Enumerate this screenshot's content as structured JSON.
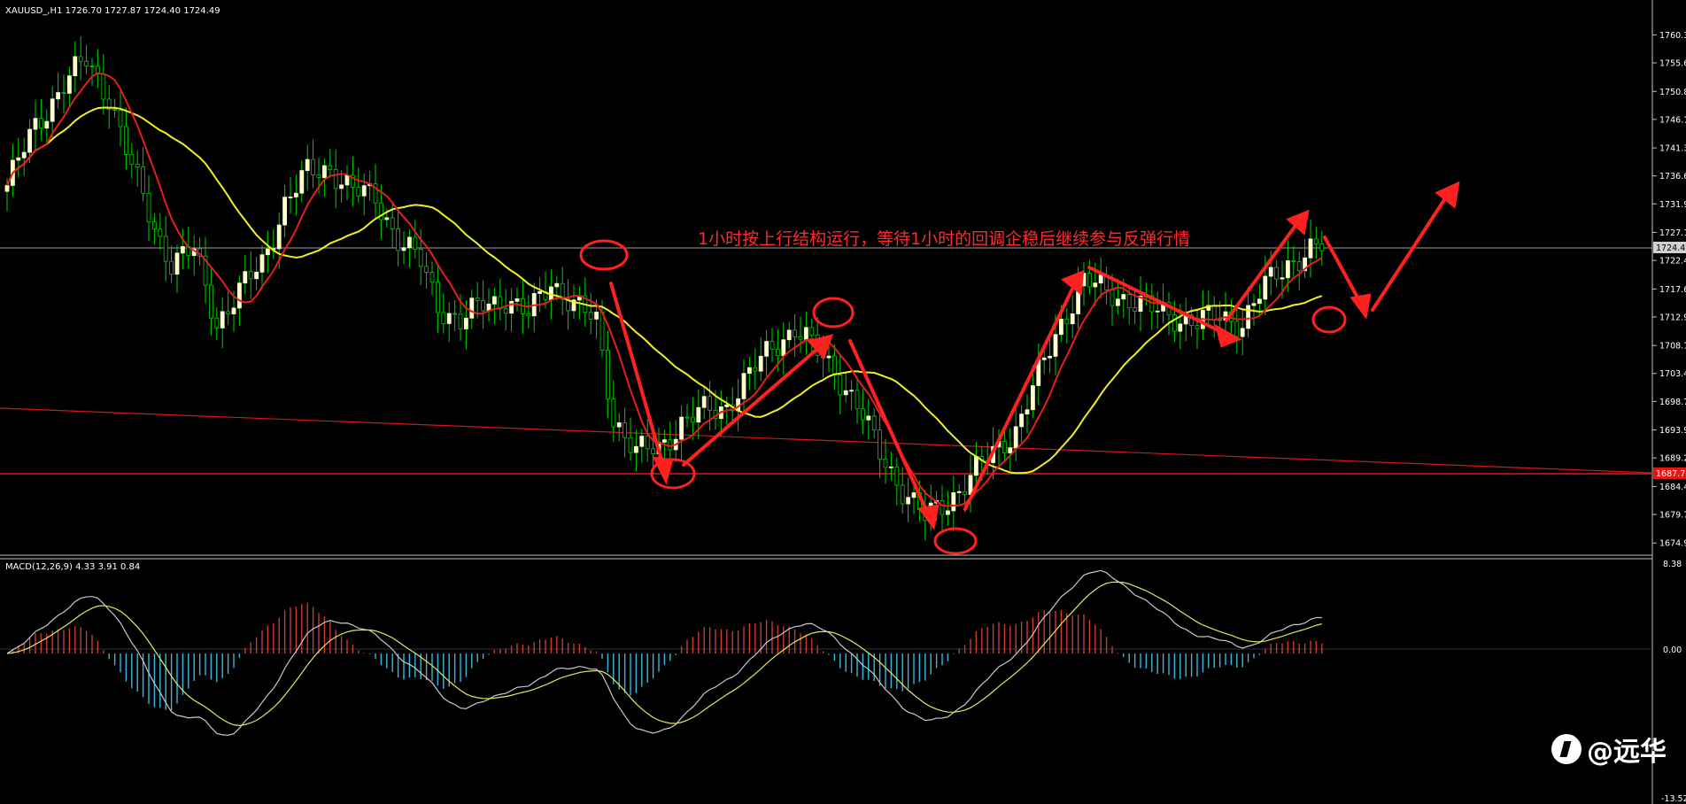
{
  "header": {
    "symbol_line": "XAUUSD_,H1  1726.70 1727.87 1724.40 1724.49",
    "macd_line": "MACD(12,26,9) 4.33 3.91 0.84"
  },
  "annotation": "1小时按上行结构运行，等待1小时的回调企稳后继续参与反弹行情",
  "watermark": "@远华",
  "price_axis": {
    "ticks": [
      "1760.3",
      "1755.6",
      "1750.8",
      "1746.1",
      "1741.3",
      "1736.6",
      "1731.9",
      "1727.1",
      "1722.4",
      "1717.6",
      "1712.9",
      "1708.1",
      "1703.4",
      "1698.7",
      "1693.9",
      "1689.2",
      "1684.4",
      "1679.7",
      "1674.9"
    ],
    "current_price": "1724.4",
    "level_price": "1687.7",
    "current_price_value": 1724.49,
    "level_price_value": 1687.7
  },
  "macd_axis": {
    "top": "8.38",
    "zero": "0.00",
    "bottom": "-13.52"
  },
  "colors": {
    "background": "#000000",
    "bull_candle": "#ffffcc",
    "candle_wick": "#00cc00",
    "ma_fast": "#e61e1e",
    "ma_slow": "#f0f020",
    "annotation": "#ff2a2a",
    "macd_pos": "#c83c28",
    "macd_neg": "#41b4dc",
    "macd_line": "#c8c8c8",
    "signal_line": "#e6e65a",
    "grid_line": "#c0c0c0"
  },
  "chart_data": {
    "type": "candlestick",
    "title": "XAUUSD_,H1",
    "ylim": [
      1674.9,
      1762.0
    ],
    "ma_periods": [
      "fast",
      "slow"
    ],
    "close_series_keypoints": [
      [
        0,
        1735
      ],
      [
        5,
        1745
      ],
      [
        10,
        1752
      ],
      [
        14,
        1756
      ],
      [
        18,
        1750
      ],
      [
        22,
        1738
      ],
      [
        26,
        1728
      ],
      [
        29,
        1722
      ],
      [
        33,
        1724
      ],
      [
        37,
        1712
      ],
      [
        41,
        1717
      ],
      [
        45,
        1722
      ],
      [
        49,
        1732
      ],
      [
        53,
        1737
      ],
      [
        57,
        1738
      ],
      [
        61,
        1734
      ],
      [
        65,
        1733
      ],
      [
        69,
        1726
      ],
      [
        73,
        1722
      ],
      [
        76,
        1715
      ],
      [
        80,
        1712
      ],
      [
        84,
        1715
      ],
      [
        88,
        1716
      ],
      [
        92,
        1713
      ],
      [
        96,
        1719
      ],
      [
        100,
        1715
      ],
      [
        104,
        1712
      ],
      [
        107,
        1696
      ],
      [
        111,
        1690
      ],
      [
        115,
        1691
      ],
      [
        119,
        1695
      ],
      [
        123,
        1697
      ],
      [
        127,
        1698
      ],
      [
        131,
        1703
      ],
      [
        135,
        1708
      ],
      [
        139,
        1711
      ],
      [
        142,
        1708
      ],
      [
        146,
        1704
      ],
      [
        150,
        1698
      ],
      [
        154,
        1690
      ],
      [
        158,
        1684
      ],
      [
        162,
        1679
      ],
      [
        166,
        1682
      ],
      [
        170,
        1686
      ],
      [
        174,
        1690
      ],
      [
        178,
        1694
      ],
      [
        182,
        1703
      ],
      [
        186,
        1712
      ],
      [
        190,
        1719
      ],
      [
        194,
        1717
      ],
      [
        198,
        1716
      ],
      [
        202,
        1714
      ],
      [
        206,
        1713
      ],
      [
        210,
        1712
      ],
      [
        214,
        1713
      ],
      [
        218,
        1712
      ],
      [
        222,
        1718
      ],
      [
        226,
        1722
      ],
      [
        230,
        1724
      ],
      [
        232,
        1724.5
      ]
    ],
    "macd": {
      "ylim": [
        -13.52,
        8.38
      ],
      "current": 4.33,
      "signal": 3.91,
      "hist": 0.84
    }
  }
}
